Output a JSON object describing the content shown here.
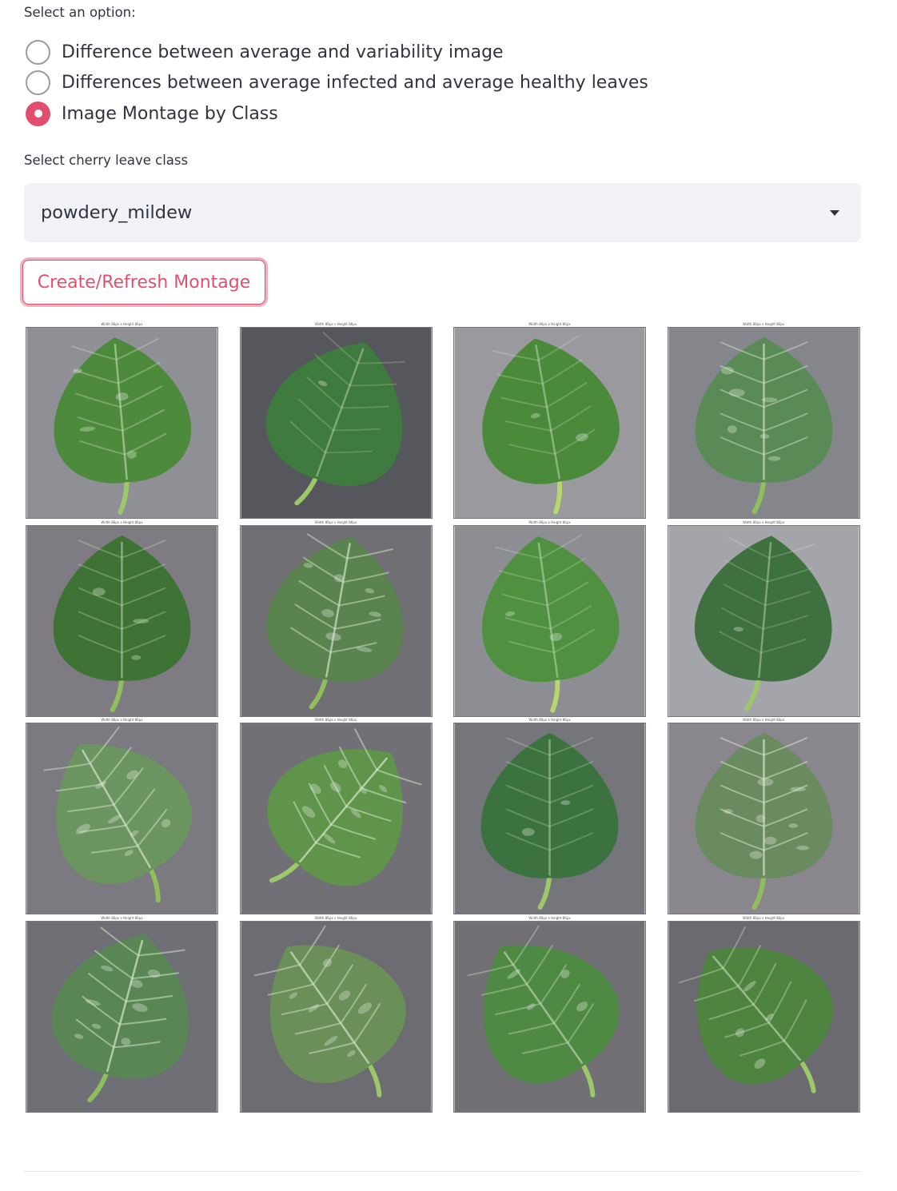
{
  "radio": {
    "label": "Select an option:",
    "options": [
      "Difference between average and variability image",
      "Differences between average infected and average healthy leaves",
      "Image Montage by Class"
    ],
    "selected_index": 2
  },
  "select": {
    "label": "Select cherry leave class",
    "value": "powdery_mildew"
  },
  "button": {
    "label": "Create/Refresh Montage"
  },
  "colors": {
    "accent": "#e0506e",
    "select_bg": "#f0f2f6",
    "text": "#31333f"
  },
  "montage": {
    "caption": "Width 86px x Height 86px",
    "images": [
      {
        "bg": "#8f8f96",
        "leaf": "#4e8a3c",
        "angle": -5,
        "stem": "#9cc86a",
        "spots": 0.25
      },
      {
        "bg": "#56575c",
        "leaf": "#3f7a3f",
        "angle": 20,
        "stem": "#9cc86a",
        "spots": 0.1
      },
      {
        "bg": "#9a999e",
        "leaf": "#4a8a3a",
        "angle": -10,
        "stem": "#b6d66e",
        "spots": 0.15
      },
      {
        "bg": "#85858c",
        "leaf": "#5a8a55",
        "angle": 0,
        "stem": "#8fbf5c",
        "spots": 0.45
      },
      {
        "bg": "#7e7c82",
        "leaf": "#3e7335",
        "angle": 0,
        "stem": "#8fbf5c",
        "spots": 0.2
      },
      {
        "bg": "#6f6f74",
        "leaf": "#5a8350",
        "angle": 10,
        "stem": "#8fbf5c",
        "spots": 0.5
      },
      {
        "bg": "#8d8e93",
        "leaf": "#4f9140",
        "angle": -8,
        "stem": "#b6d66e",
        "spots": 0.15
      },
      {
        "bg": "#a4a5aa",
        "leaf": "#3f7040",
        "angle": 5,
        "stem": "#9cc86a",
        "spots": 0.1
      },
      {
        "bg": "#7a7a80",
        "leaf": "#6b9460",
        "angle": -30,
        "stem": "#8fbf5c",
        "spots": 0.5
      },
      {
        "bg": "#707076",
        "leaf": "#5f944a",
        "angle": 40,
        "stem": "#9cc86a",
        "spots": 0.55
      },
      {
        "bg": "#75767b",
        "leaf": "#3c7240",
        "angle": 0,
        "stem": "#9cc86a",
        "spots": 0.15
      },
      {
        "bg": "#8a868e",
        "leaf": "#6a8a60",
        "angle": 0,
        "stem": "#8fbf5c",
        "spots": 0.55
      },
      {
        "bg": "#6f7075",
        "leaf": "#5a8656",
        "angle": 15,
        "stem": "#8fbf5c",
        "spots": 0.55
      },
      {
        "bg": "#6c6c72",
        "leaf": "#6a8f58",
        "angle": -35,
        "stem": "#9cc86a",
        "spots": 0.5
      },
      {
        "bg": "#707075",
        "leaf": "#4f8a45",
        "angle": -35,
        "stem": "#9cc86a",
        "spots": 0.3
      },
      {
        "bg": "#6a6a70",
        "leaf": "#4f8440",
        "angle": -40,
        "stem": "#9cc86a",
        "spots": 0.3
      }
    ]
  }
}
